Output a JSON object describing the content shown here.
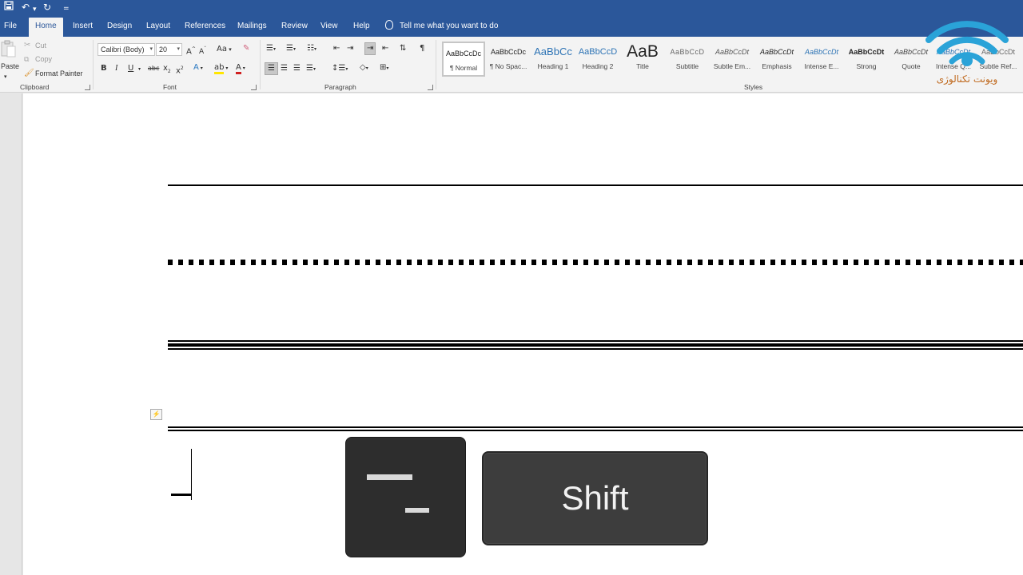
{
  "qat": {
    "save_icon": "save-icon",
    "undo_icon": "undo-icon",
    "redo_icon": "redo-icon",
    "customize_icon": "customize-qat-icon"
  },
  "tabs": [
    {
      "label": "File"
    },
    {
      "label": "Home"
    },
    {
      "label": "Insert"
    },
    {
      "label": "Design"
    },
    {
      "label": "Layout"
    },
    {
      "label": "References"
    },
    {
      "label": "Mailings"
    },
    {
      "label": "Review"
    },
    {
      "label": "View"
    },
    {
      "label": "Help"
    }
  ],
  "tell_me": "Tell me what you want to do",
  "clipboard": {
    "paste_label": "Paste",
    "cut_label": "Cut",
    "copy_label": "Copy",
    "format_painter_label": "Format Painter",
    "group_label": "Clipboard"
  },
  "font": {
    "family_value": "Calibri (Body)",
    "size_value": "20",
    "grow": "A",
    "shrink": "A",
    "case": "Aa",
    "bold": "B",
    "italic": "I",
    "underline": "U",
    "strike": "abc",
    "subscript": "x",
    "superscript": "x",
    "group_label": "Font"
  },
  "paragraph": {
    "pilcrow": "¶",
    "group_label": "Paragraph"
  },
  "styles": {
    "group_label": "Styles",
    "items": [
      {
        "preview": "AaBbCcDc",
        "name": "¶ Normal"
      },
      {
        "preview": "AaBbCcDc",
        "name": "¶ No Spac..."
      },
      {
        "preview": "AaBbCc",
        "name": "Heading 1"
      },
      {
        "preview": "AaBbCcD",
        "name": "Heading 2"
      },
      {
        "preview": "AaB",
        "name": "Title"
      },
      {
        "preview": "AaBbCcD",
        "name": "Subtitle"
      },
      {
        "preview": "AaBbCcDt",
        "name": "Subtle Em..."
      },
      {
        "preview": "AaBbCcDt",
        "name": "Emphasis"
      },
      {
        "preview": "AaBbCcDt",
        "name": "Intense E..."
      },
      {
        "preview": "AaBbCcDt",
        "name": "Strong"
      },
      {
        "preview": "AaBbCcDt",
        "name": "Quote"
      },
      {
        "preview": "AaBbCcDt",
        "name": "Intense Q..."
      },
      {
        "preview": "AaBbCcDt",
        "name": "Subtle Ref..."
      }
    ]
  },
  "keys": {
    "shift_label": "Shift",
    "minus_key_icon": "minus-underscore-key"
  },
  "logo": {
    "text": "ویونت تکنالوژی"
  },
  "colors": {
    "ribbon_blue": "#2b579a",
    "page": "#ffffff",
    "key_dark": "#2d2d2d",
    "logo_blue": "#2aa3d8",
    "logo_orange": "#c06a1f"
  }
}
